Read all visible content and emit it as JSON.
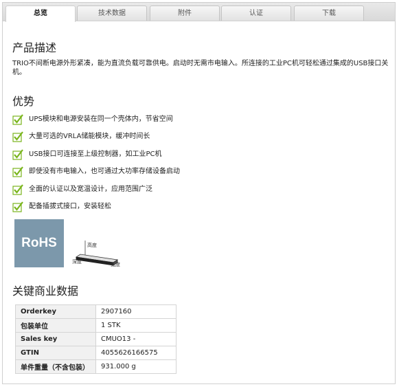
{
  "tabs": [
    {
      "label": "总览",
      "active": true
    },
    {
      "label": "技术数据",
      "active": false
    },
    {
      "label": "附件",
      "active": false
    },
    {
      "label": "认证",
      "active": false
    },
    {
      "label": "下载",
      "active": false
    }
  ],
  "description": {
    "title": "产品描述",
    "text": "TRIO不间断电源外形紧凑，能为直流负载可靠供电。启动时无需市电输入。所连接的工业PC机可轻松通过集成的USB接口关机。"
  },
  "advantages": {
    "title": "优势",
    "items": [
      "UPS模块和电源安装在同一个壳体内，节省空间",
      "大量可选的VRLA储能模块，缓冲时间长",
      "USB接口可连接至上级控制器，如工业PC机",
      "即使没有市电输入，也可通过大功率存储设备启动",
      "全面的认证以及宽温设计，应用范围广泛",
      "配备插拔式接口，安装轻松"
    ],
    "check_color": "#7ab51d"
  },
  "badges": {
    "rohs": "RoHS",
    "dimensions": {
      "height": "高度",
      "depth": "深度",
      "width": "宽度"
    }
  },
  "key_data": {
    "title": "关键商业数据",
    "rows": [
      {
        "key": "Orderkey",
        "value": "2907160"
      },
      {
        "key": "包装单位",
        "value": "1 STK"
      },
      {
        "key": "Sales key",
        "value": "CMUO13 -"
      },
      {
        "key": "GTIN",
        "value": "4055626166575"
      },
      {
        "key": "单件重量（不含包装）",
        "value": "931.000 g"
      }
    ]
  }
}
